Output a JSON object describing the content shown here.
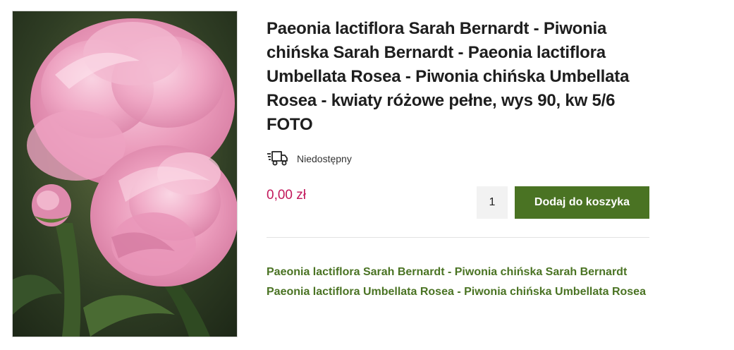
{
  "product": {
    "image_alt": "Paeonia lactiflora Sarah Bernardt pink peony photo",
    "title": "Paeonia lactiflora Sarah Bernardt - Piwonia chińska Sarah Bernardt - Paeonia lactiflora Umbellata Rosea - Piwonia chińska Umbellata Rosea - kwiaty różowe pełne, wys 90, kw 5/6 FOTO",
    "availability": {
      "icon": "delivery-truck-icon",
      "label": "Niedostępny"
    },
    "price": "0,00 zł",
    "quantity": "1",
    "add_to_cart_label": "Dodaj do koszyka",
    "description_link": "Paeonia lactiflora Sarah Bernardt - Piwonia chińska Sarah Bernardt Paeonia lactiflora Umbellata Rosea - Piwonia chińska Umbellata Rosea"
  },
  "colors": {
    "accent_green": "#4a7323",
    "price_pink": "#c2185b"
  }
}
